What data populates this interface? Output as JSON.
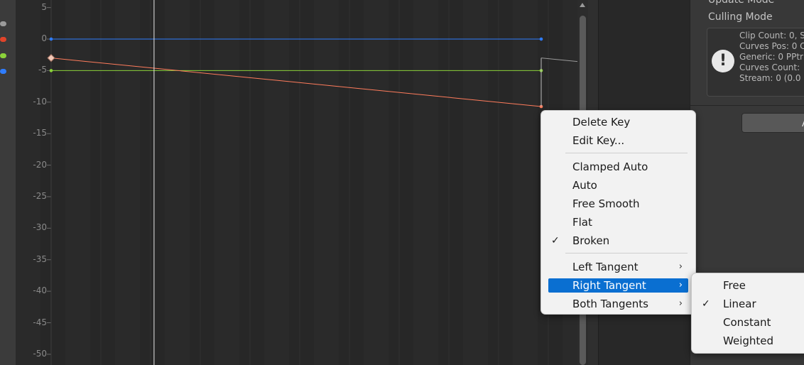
{
  "colors": {
    "background": "#272727",
    "curve_blue": "#2f7dff",
    "curve_green": "#8bd23a",
    "curve_red": "#ff7c5c",
    "highlight": "#0a6fd1"
  },
  "curve_swatches": [
    {
      "name": "gray",
      "color": "#9a9a9a"
    },
    {
      "name": "red",
      "color": "#e0442a"
    },
    {
      "name": "green",
      "color": "#8bd23a"
    },
    {
      "name": "blue",
      "color": "#2f7dff"
    }
  ],
  "axis": {
    "ticks": [
      "5",
      "0",
      "-5",
      "-10",
      "-15",
      "-20",
      "-25",
      "-30",
      "-35",
      "-40",
      "-45",
      "-50"
    ]
  },
  "chart_data": {
    "type": "line",
    "ylim": [
      -51.7,
      6.2
    ],
    "time_cursor": 0.21,
    "series": [
      {
        "color": "#2f7dff",
        "points": [
          [
            0,
            0
          ],
          [
            1,
            0
          ]
        ]
      },
      {
        "color": "#8bd23a",
        "points": [
          [
            0,
            -5
          ],
          [
            1,
            -5
          ]
        ]
      },
      {
        "color": "#ff7c5c",
        "points": [
          [
            0,
            -3
          ],
          [
            1,
            -10.7
          ]
        ]
      }
    ]
  },
  "inspector": {
    "update_mode_label": "Update Mode",
    "culling_mode_label": "Culling Mode",
    "info_icon": "warning-icon",
    "info_lines": [
      "Clip Count: 0, S",
      "Curves Pos: 0 C",
      "Generic: 0 PPtr",
      "Curves Count:",
      "Stream: 0 (0.0"
    ],
    "button_label": "A"
  },
  "context_menu": {
    "items": [
      {
        "label": "Delete Key",
        "checked": false,
        "submenu": false
      },
      {
        "label": "Edit Key...",
        "checked": false,
        "submenu": false
      },
      {
        "label": "Clamped Auto",
        "checked": false,
        "submenu": false
      },
      {
        "label": "Auto",
        "checked": false,
        "submenu": false
      },
      {
        "label": "Free Smooth",
        "checked": false,
        "submenu": false
      },
      {
        "label": "Flat",
        "checked": false,
        "submenu": false
      },
      {
        "label": "Broken",
        "checked": true,
        "submenu": false
      },
      {
        "label": "Left Tangent",
        "checked": false,
        "submenu": true
      },
      {
        "label": "Right Tangent",
        "checked": false,
        "submenu": true,
        "highlighted": true
      },
      {
        "label": "Both Tangents",
        "checked": false,
        "submenu": true
      }
    ]
  },
  "submenu": {
    "items": [
      {
        "label": "Free",
        "checked": false
      },
      {
        "label": "Linear",
        "checked": true
      },
      {
        "label": "Constant",
        "checked": false
      },
      {
        "label": "Weighted",
        "checked": false
      }
    ]
  },
  "glyphs": {
    "check": "✓",
    "submenu_arrow": "›"
  }
}
